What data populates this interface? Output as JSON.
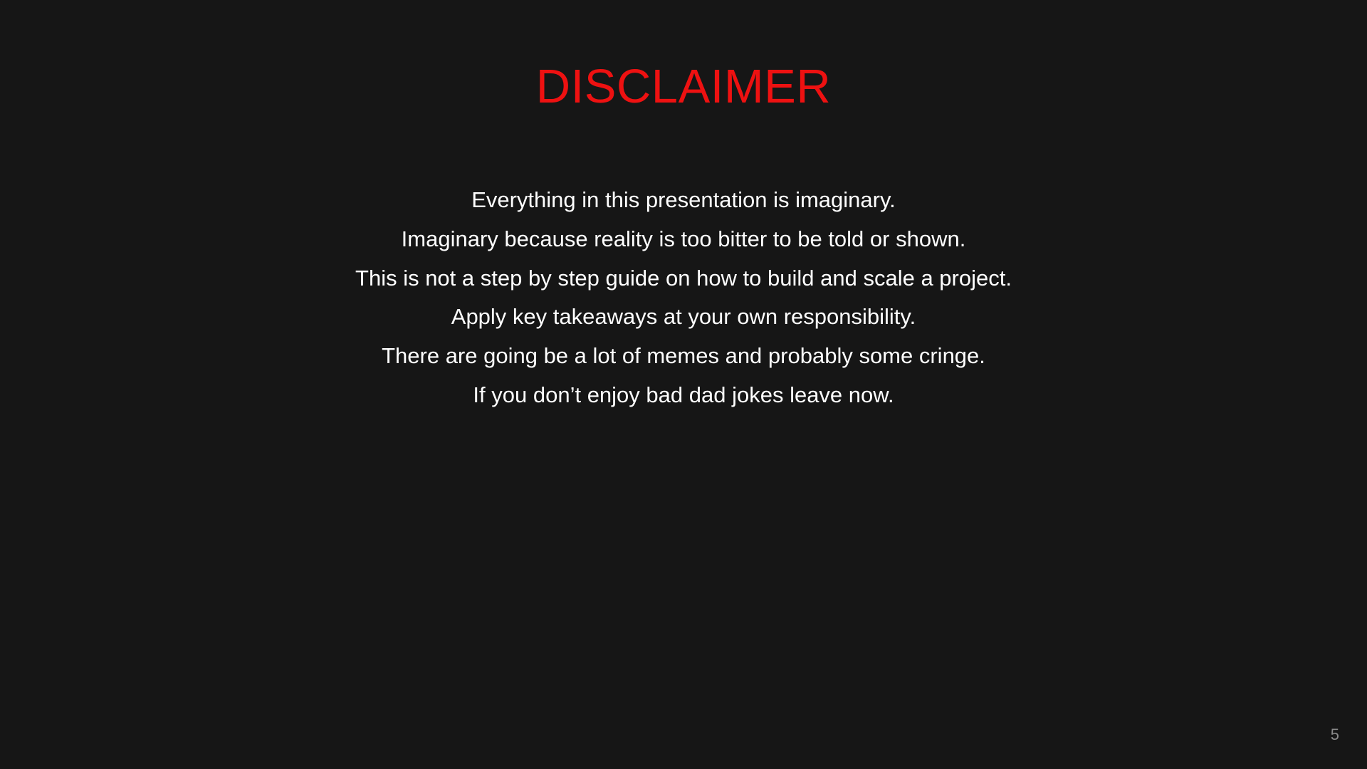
{
  "slide": {
    "title": "DISCLAIMER",
    "lines": [
      "Everything in this presentation is imaginary.",
      "Imaginary because reality is too bitter to be told or shown.",
      "This is not a step by step guide on how to build and scale a project.",
      "Apply key takeaways at your own responsibility.",
      "There are going be a lot of memes and probably some cringe.",
      "If you don’t enjoy bad dad jokes leave now."
    ],
    "page_number": "5"
  },
  "colors": {
    "background": "#161616",
    "title": "#ee1111",
    "body_text": "#ffffff",
    "page_number": "#8a8a8a"
  }
}
